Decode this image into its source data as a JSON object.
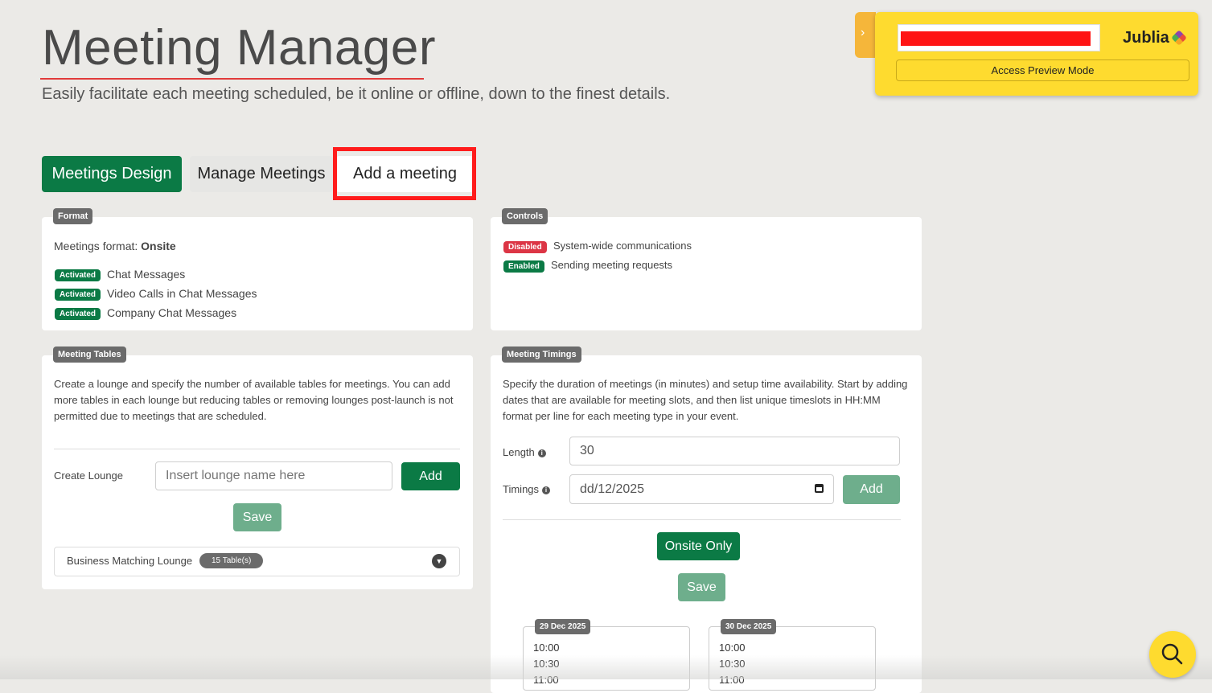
{
  "header": {
    "title": "Meeting Manager",
    "subtitle": "Easily facilitate each meeting scheduled, be it online or offline, down to the finest details."
  },
  "tabs": {
    "design": "Meetings Design",
    "manage": "Manage Meetings",
    "add": "Add a meeting"
  },
  "preview": {
    "logo": "Jublia",
    "button": "Access Preview Mode"
  },
  "format_card": {
    "tag": "Format",
    "format_label": "Meetings format: ",
    "format_value": "Onsite",
    "items": [
      {
        "badge": "Activated",
        "label": "Chat Messages"
      },
      {
        "badge": "Activated",
        "label": "Video Calls in Chat Messages"
      },
      {
        "badge": "Activated",
        "label": "Company Chat Messages"
      }
    ]
  },
  "controls_card": {
    "tag": "Controls",
    "items": [
      {
        "badge": "Disabled",
        "label": "System-wide communications"
      },
      {
        "badge": "Enabled",
        "label": "Sending meeting requests"
      }
    ]
  },
  "tables_card": {
    "tag": "Meeting Tables",
    "description": "Create a lounge and specify the number of available tables for meetings. You can add more tables in each lounge but reducing tables or removing lounges post-launch is not permitted due to meetings that are scheduled.",
    "create_label": "Create Lounge",
    "input_placeholder": "Insert lounge name here",
    "add_button": "Add",
    "save_button": "Save",
    "lounge_name": "Business Matching Lounge",
    "lounge_tables": "15 Table(s)"
  },
  "timings_card": {
    "tag": "Meeting Timings",
    "description": "Specify the duration of meetings (in minutes) and setup time availability. Start by adding dates that are available for meeting slots, and then list unique timeslots in HH:MM format per line for each meeting type in your event.",
    "length_label": "Length",
    "length_value": "30",
    "timings_label": "Timings",
    "date_value": "dd/12/2025",
    "add_button": "Add",
    "onsite_button": "Onsite Only",
    "save_button": "Save",
    "dates": [
      {
        "date": "29 Dec 2025",
        "slots": [
          "10:00",
          "10:30",
          "11:00"
        ]
      },
      {
        "date": "30 Dec 2025",
        "slots": [
          "10:00",
          "10:30",
          "11:00"
        ]
      }
    ]
  },
  "colors": {
    "primary": "#0b7a45",
    "highlight": "#ff1c1c",
    "widget": "#fedb2f"
  }
}
